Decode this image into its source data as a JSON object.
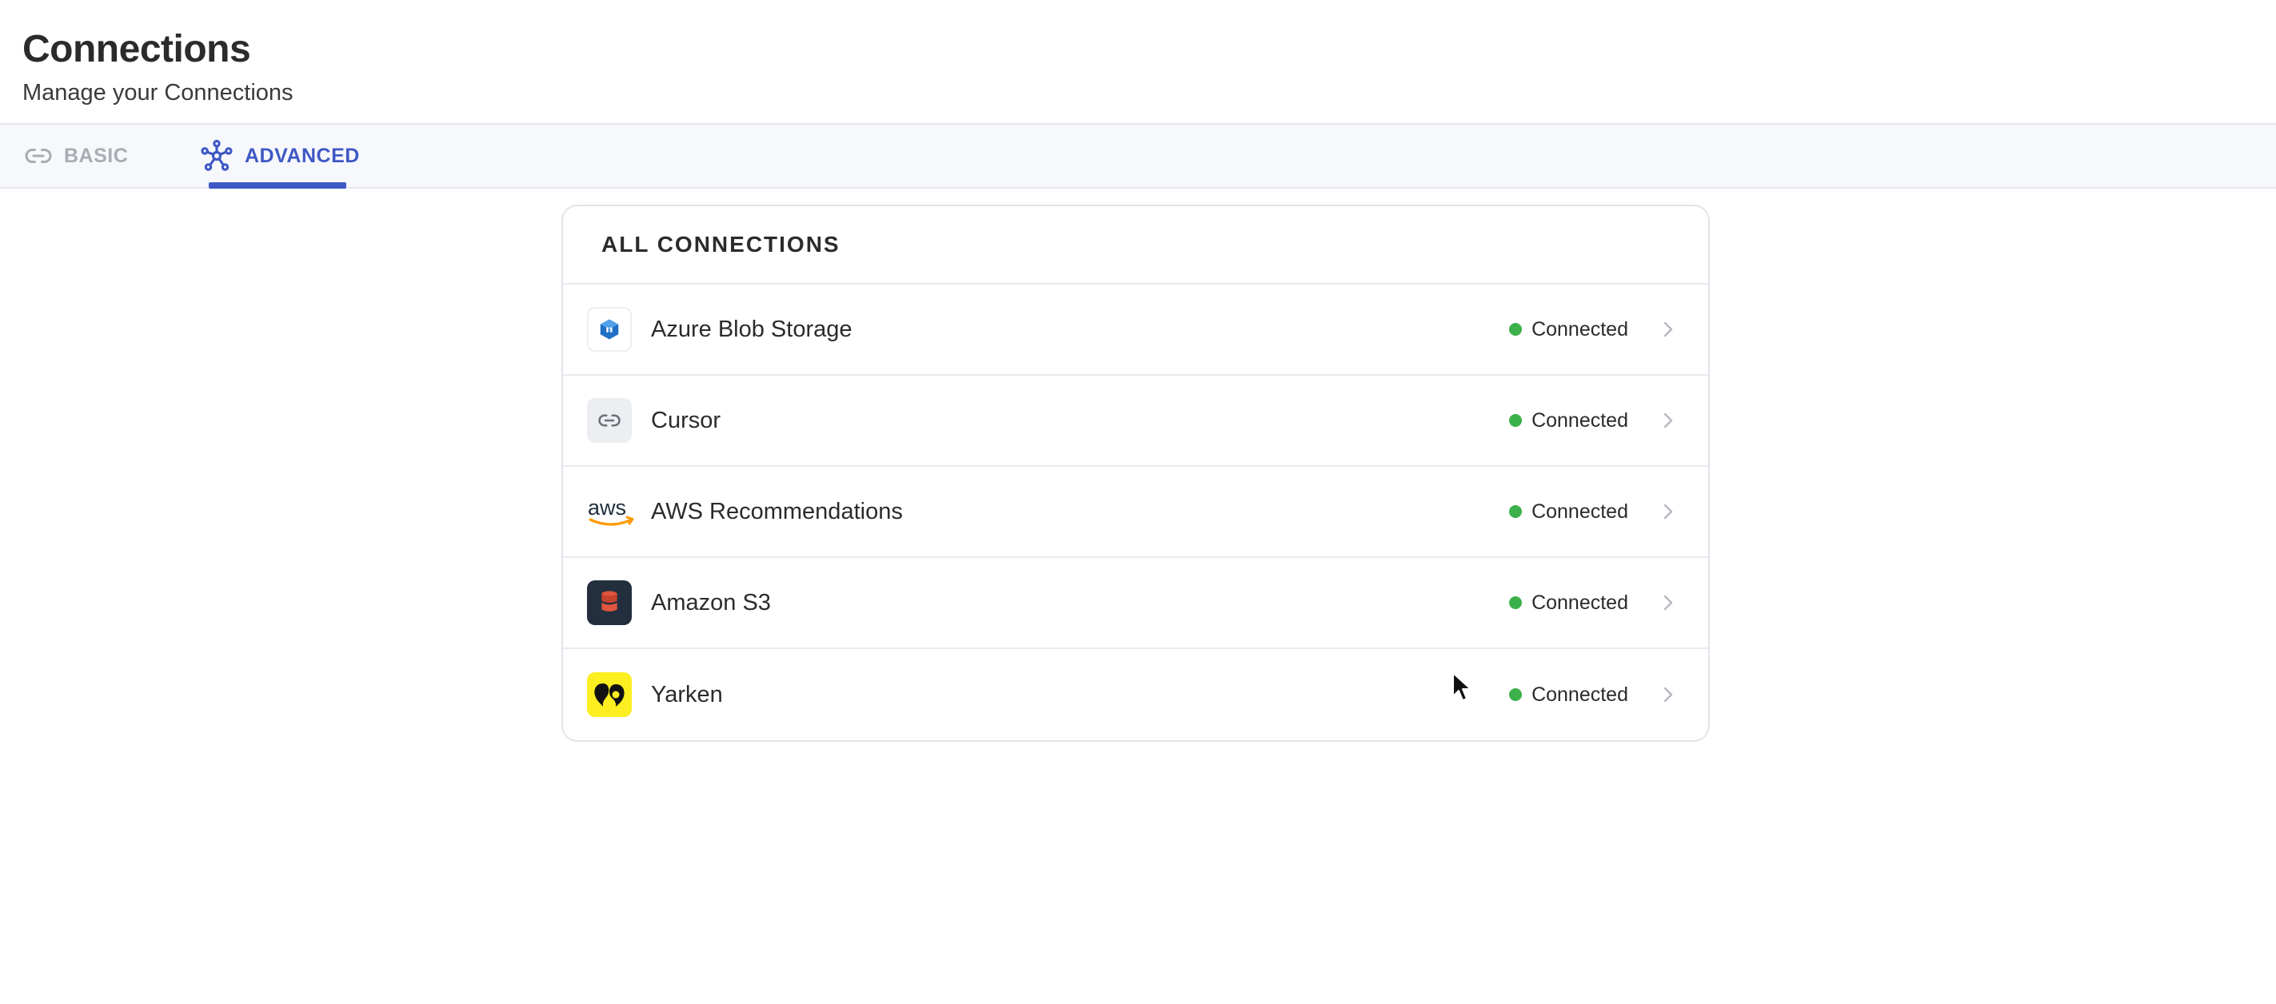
{
  "header": {
    "title": "Connections",
    "subtitle": "Manage your Connections"
  },
  "tabs": [
    {
      "label": "BASIC",
      "icon": "link-icon",
      "active": false
    },
    {
      "label": "ADVANCED",
      "icon": "network-icon",
      "active": true
    }
  ],
  "card": {
    "title": "ALL CONNECTIONS",
    "rows": [
      {
        "name": "Azure Blob Storage",
        "status": "Connected",
        "logo": "azure-blob-storage-logo"
      },
      {
        "name": "Cursor",
        "status": "Connected",
        "logo": "link-icon"
      },
      {
        "name": "AWS Recommendations",
        "status": "Connected",
        "logo": "aws-logo"
      },
      {
        "name": "Amazon S3",
        "status": "Connected",
        "logo": "amazon-s3-logo"
      },
      {
        "name": "Yarken",
        "status": "Connected",
        "logo": "yarken-logo"
      }
    ]
  },
  "colors": {
    "accent": "#3f58c4",
    "status_connected": "#3cb04a",
    "inactive_tab": "#a9acb3"
  }
}
